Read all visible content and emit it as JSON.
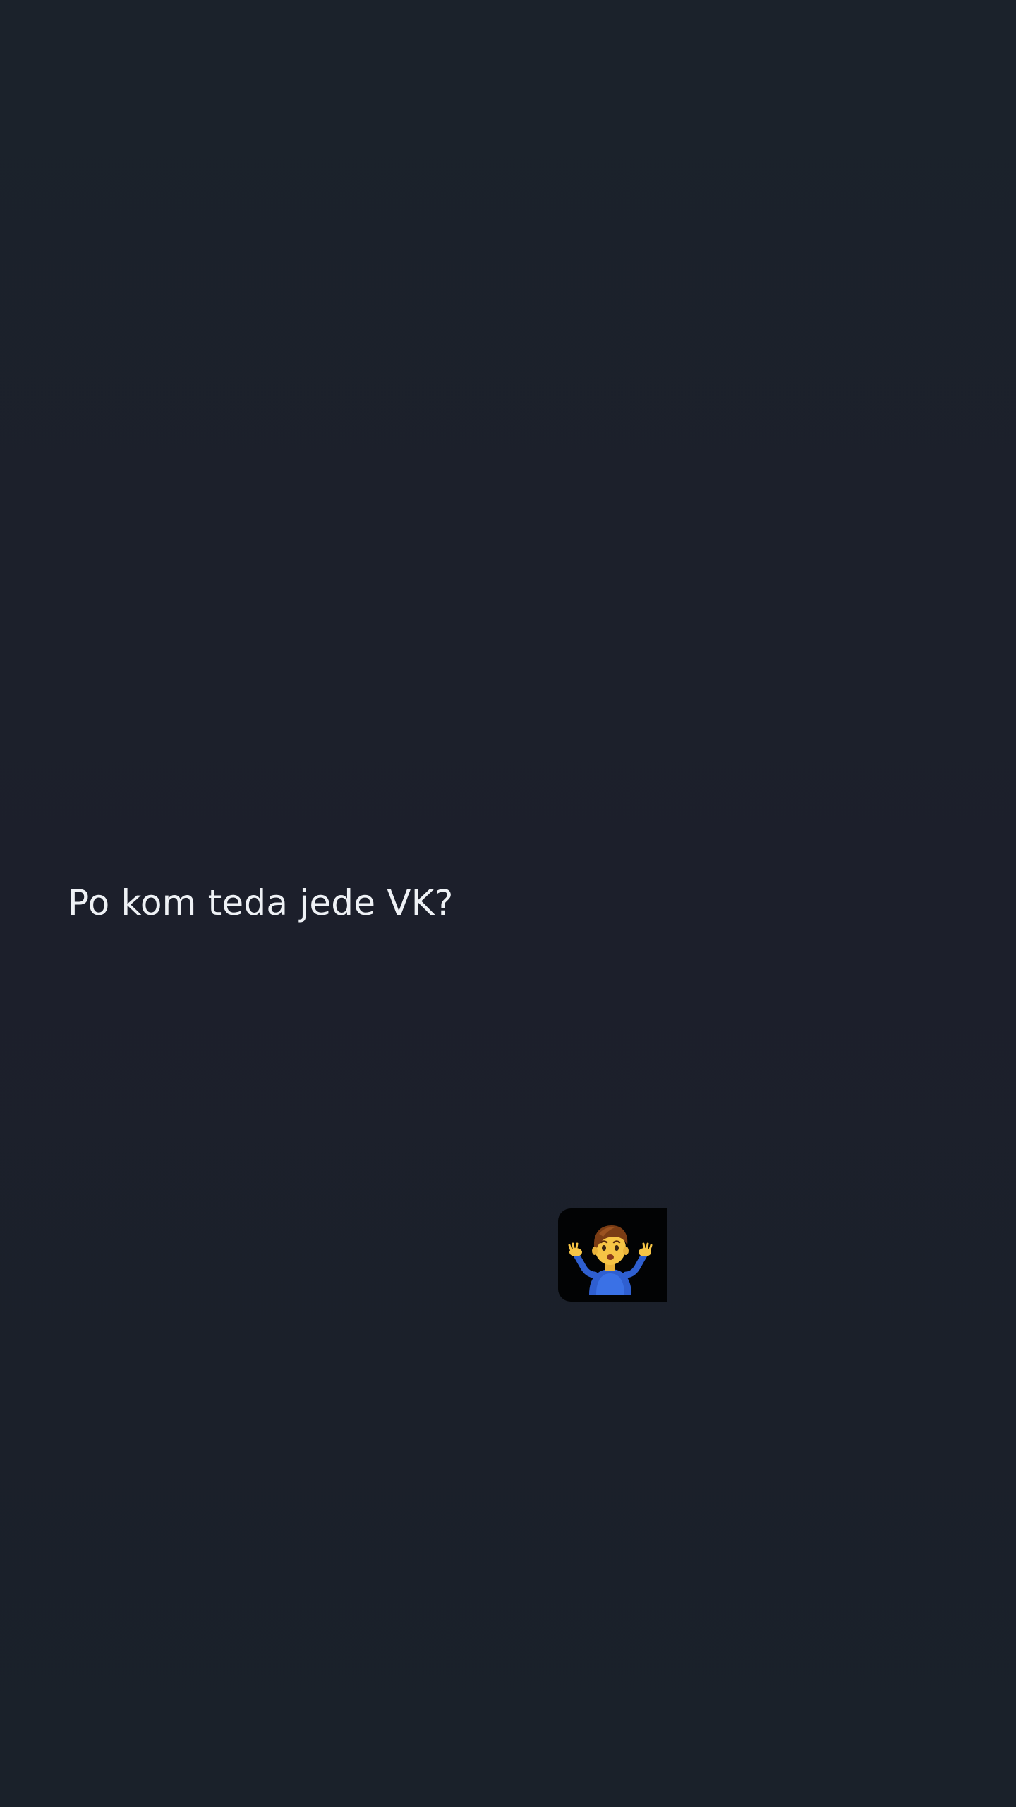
{
  "story": {
    "question_text": "Po kom teda jede VK?",
    "sticker_icon": "person-shrugging-icon"
  },
  "colors": {
    "background": "#1c212b",
    "text": "#eef1f5",
    "sticker_background": "#020304"
  }
}
